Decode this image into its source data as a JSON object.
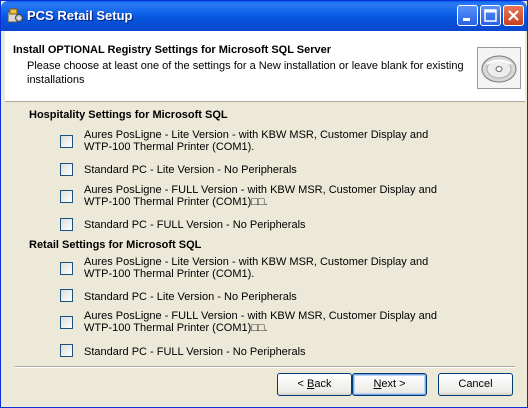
{
  "window": {
    "title": "PCS Retail Setup",
    "icons": {
      "app": "setup-icon",
      "minimize": "minimize-icon",
      "maximize": "maximize-icon",
      "close": "close-icon"
    }
  },
  "header": {
    "title": "Install OPTIONAL Registry Settings for Microsoft SQL Server",
    "subtitle": "Please choose at least one of the settings for a New installation or leave blank for existing installations",
    "icon": "cd-disc-icon"
  },
  "hospitality": {
    "heading": "Hospitality Settings for Microsoft SQL",
    "options": [
      {
        "label_line1": "Aures PosLigne - Lite Version - with KBW MSR, Customer Display and",
        "label_line2": "WTP-100 Thermal Printer (COM1).",
        "checked": false
      },
      {
        "label_line1": "Standard PC - Lite Version - No Peripherals",
        "label_line2": "",
        "checked": false
      },
      {
        "label_line1": "Aures PosLigne - FULL Version - with KBW MSR, Customer Display and",
        "label_line2": "WTP-100 Thermal Printer (COM1)□□.",
        "checked": false
      },
      {
        "label_line1": "Standard PC - FULL Version - No Peripherals",
        "label_line2": "",
        "checked": false
      }
    ]
  },
  "retail": {
    "heading": "Retail Settings for Microsoft SQL",
    "options": [
      {
        "label_line1": "Aures PosLigne - Lite Version - with KBW MSR, Customer Display and",
        "label_line2": "WTP-100 Thermal Printer (COM1).",
        "checked": false
      },
      {
        "label_line1": "Standard PC - Lite Version - No Peripherals",
        "label_line2": "",
        "checked": false
      },
      {
        "label_line1": "Aures PosLigne - FULL Version - with KBW MSR, Customer Display and",
        "label_line2": "WTP-100 Thermal Printer (COM1)□□.",
        "checked": false
      },
      {
        "label_line1": "Standard PC - FULL Version - No Peripherals",
        "label_line2": "",
        "checked": false
      }
    ]
  },
  "buttons": {
    "back": {
      "prefix": "< ",
      "accel": "B",
      "rest": "ack"
    },
    "next": {
      "accel": "N",
      "rest": "ext >"
    },
    "cancel": "Cancel"
  }
}
